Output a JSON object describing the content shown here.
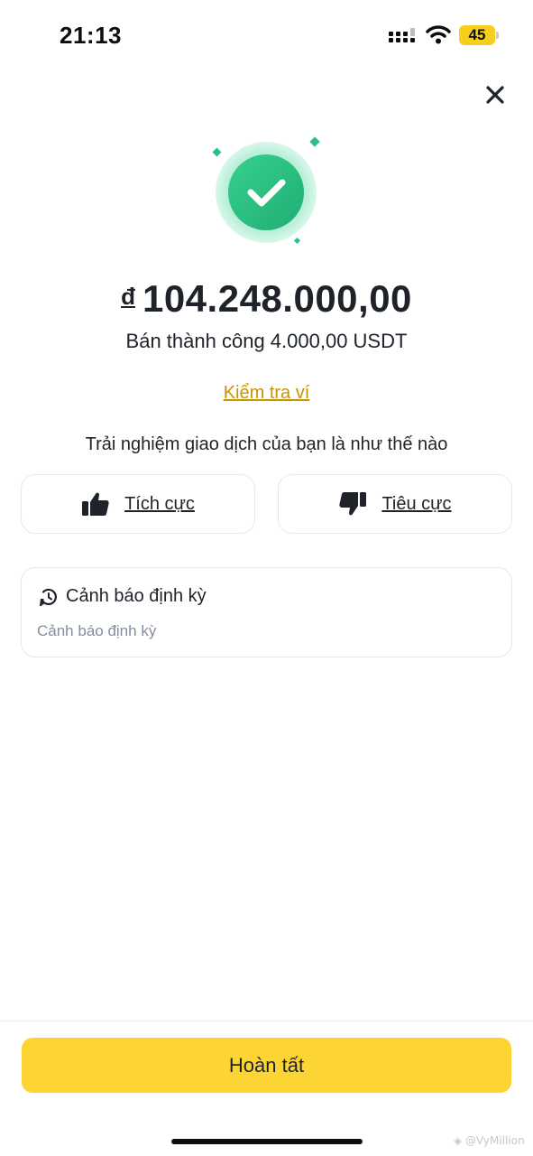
{
  "status_bar": {
    "time": "21:13",
    "battery_level": "45",
    "icons": [
      "cellular-signal-icon",
      "wifi-icon",
      "battery-icon"
    ]
  },
  "header": {
    "close_icon": "close-icon"
  },
  "result": {
    "icon": "success-check-icon",
    "currency_symbol": "đ",
    "amount": "104.248.000,00",
    "status_text": "Bán thành công 4.000,00 USDT",
    "check_wallet_link": "Kiểm tra ví"
  },
  "feedback": {
    "question": "Trải nghiệm giao dịch của bạn là như thế nào",
    "positive_label": "Tích cực",
    "negative_label": "Tiêu cực",
    "positive_icon": "thumbs-up-icon",
    "negative_icon": "thumbs-down-icon"
  },
  "alert": {
    "icon": "recurring-alert-icon",
    "title": "Cảnh báo định kỳ",
    "subtitle": "Cảnh báo định kỳ"
  },
  "footer": {
    "done_label": "Hoàn tất"
  },
  "watermark": "◈ @VyMillion",
  "colors": {
    "accent_yellow": "#fcd535",
    "link_gold": "#c99400",
    "success_green": "#2ebd85",
    "text_primary": "#1e2329",
    "text_secondary": "#848e9c"
  }
}
